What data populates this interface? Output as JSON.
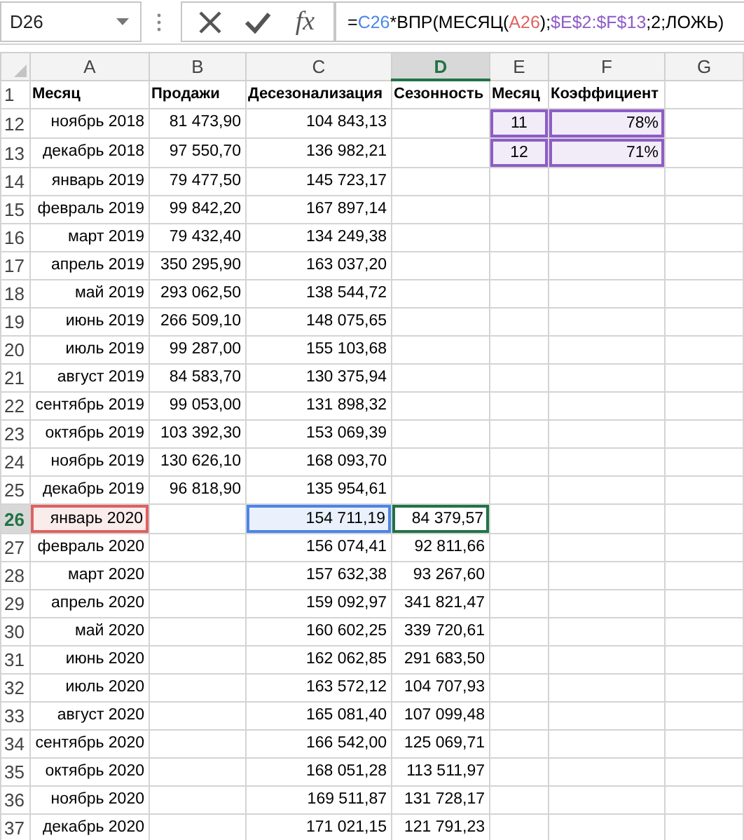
{
  "name_box": "D26",
  "function_button": "fx",
  "formula": [
    {
      "text": "=",
      "color": "#000000"
    },
    {
      "text": "C26",
      "color": "#4a86e8"
    },
    {
      "text": "*ВПР(МЕСЯЦ(",
      "color": "#000000"
    },
    {
      "text": "A26",
      "color": "#e06060"
    },
    {
      "text": ");",
      "color": "#000000"
    },
    {
      "text": "$E$2:$F$13",
      "color": "#8e5cc8"
    },
    {
      "text": ";2;ЛОЖЬ)",
      "color": "#000000"
    }
  ],
  "columns": [
    {
      "label": "A",
      "selected": false
    },
    {
      "label": "B",
      "selected": false
    },
    {
      "label": "C",
      "selected": false
    },
    {
      "label": "D",
      "selected": true
    },
    {
      "label": "E",
      "selected": false
    },
    {
      "label": "F",
      "selected": false
    },
    {
      "label": "G",
      "selected": false
    }
  ],
  "rows": [
    {
      "row": "1",
      "kind": "header",
      "selected": false,
      "cells": [
        "Месяц",
        "Продажи",
        "Десезонализация",
        "Сезонность",
        "Месяц",
        "Коэффициент",
        ""
      ]
    },
    {
      "row": "12",
      "kind": "data",
      "selected": false,
      "cells": [
        "ноябрь 2018",
        "81 473,90",
        "104 843,13",
        "",
        {
          "text": "11",
          "color": "#8e5cc8"
        },
        {
          "text": "78%",
          "color": "#8e5cc8"
        },
        ""
      ]
    },
    {
      "row": "13",
      "kind": "data",
      "selected": false,
      "cells": [
        "декабрь 2018",
        "97 550,70",
        "136 982,21",
        "",
        {
          "text": "12",
          "color": "#8e5cc8"
        },
        {
          "text": "71%",
          "color": "#8e5cc8"
        },
        ""
      ]
    },
    {
      "row": "14",
      "kind": "data",
      "selected": false,
      "cells": [
        "январь 2019",
        "79 477,50",
        "145 723,17",
        "",
        "",
        "",
        ""
      ]
    },
    {
      "row": "15",
      "kind": "data",
      "selected": false,
      "cells": [
        "февраль 2019",
        "99 842,20",
        "167 897,14",
        "",
        "",
        "",
        ""
      ]
    },
    {
      "row": "16",
      "kind": "data",
      "selected": false,
      "cells": [
        "март 2019",
        "79 432,40",
        "134 249,38",
        "",
        "",
        "",
        ""
      ]
    },
    {
      "row": "17",
      "kind": "data",
      "selected": false,
      "cells": [
        "апрель 2019",
        "350 295,90",
        "163 037,20",
        "",
        "",
        "",
        ""
      ]
    },
    {
      "row": "18",
      "kind": "data",
      "selected": false,
      "cells": [
        "май 2019",
        "293 062,50",
        "138 544,72",
        "",
        "",
        "",
        ""
      ]
    },
    {
      "row": "19",
      "kind": "data",
      "selected": false,
      "cells": [
        "июнь 2019",
        "266 509,10",
        "148 075,65",
        "",
        "",
        "",
        ""
      ]
    },
    {
      "row": "20",
      "kind": "data",
      "selected": false,
      "cells": [
        "июль 2019",
        "99 287,00",
        "155 103,68",
        "",
        "",
        "",
        ""
      ]
    },
    {
      "row": "21",
      "kind": "data",
      "selected": false,
      "cells": [
        "август 2019",
        "84 583,70",
        "130 375,94",
        "",
        "",
        "",
        ""
      ]
    },
    {
      "row": "22",
      "kind": "data",
      "selected": false,
      "cells": [
        "сентябрь 2019",
        "99 053,00",
        "131 898,32",
        "",
        "",
        "",
        ""
      ]
    },
    {
      "row": "23",
      "kind": "data",
      "selected": false,
      "cells": [
        "октябрь 2019",
        "103 392,30",
        "153 069,39",
        "",
        "",
        "",
        ""
      ]
    },
    {
      "row": "24",
      "kind": "data",
      "selected": false,
      "cells": [
        "ноябрь 2019",
        "130 626,10",
        "168 093,70",
        "",
        "",
        "",
        ""
      ]
    },
    {
      "row": "25",
      "kind": "data",
      "selected": false,
      "cells": [
        "декабрь 2019",
        "96 818,90",
        "135 954,61",
        "",
        "",
        "",
        ""
      ]
    },
    {
      "row": "26",
      "kind": "data",
      "selected": true,
      "cells": [
        {
          "text": "январь 2020",
          "color": "#e06060"
        },
        "",
        {
          "text": "154 711,19",
          "color": "#4a86e8"
        },
        {
          "text": "84 379,57",
          "selected": true
        },
        "",
        "",
        ""
      ]
    },
    {
      "row": "27",
      "kind": "data",
      "selected": false,
      "cells": [
        "февраль 2020",
        "",
        "156 074,41",
        "92 811,66",
        "",
        "",
        ""
      ]
    },
    {
      "row": "28",
      "kind": "data",
      "selected": false,
      "cells": [
        "март 2020",
        "",
        "157 632,38",
        "93 267,60",
        "",
        "",
        ""
      ]
    },
    {
      "row": "29",
      "kind": "data",
      "selected": false,
      "cells": [
        "апрель 2020",
        "",
        "159 092,97",
        "341 821,47",
        "",
        "",
        ""
      ]
    },
    {
      "row": "30",
      "kind": "data",
      "selected": false,
      "cells": [
        "май 2020",
        "",
        "160 602,25",
        "339 720,61",
        "",
        "",
        ""
      ]
    },
    {
      "row": "31",
      "kind": "data",
      "selected": false,
      "cells": [
        "июнь 2020",
        "",
        "162 062,85",
        "291 683,50",
        "",
        "",
        ""
      ]
    },
    {
      "row": "32",
      "kind": "data",
      "selected": false,
      "cells": [
        "июль 2020",
        "",
        "163 572,12",
        "104 707,93",
        "",
        "",
        ""
      ]
    },
    {
      "row": "33",
      "kind": "data",
      "selected": false,
      "cells": [
        "август 2020",
        "",
        "165 081,40",
        "107 099,48",
        "",
        "",
        ""
      ]
    },
    {
      "row": "34",
      "kind": "data",
      "selected": false,
      "cells": [
        "сентябрь 2020",
        "",
        "166 542,00",
        "125 069,71",
        "",
        "",
        ""
      ]
    },
    {
      "row": "35",
      "kind": "data",
      "selected": false,
      "cells": [
        "октябрь 2020",
        "",
        "168 051,28",
        "113 511,97",
        "",
        "",
        ""
      ]
    },
    {
      "row": "36",
      "kind": "data",
      "selected": false,
      "cells": [
        "ноябрь 2020",
        "",
        "169 511,87",
        "131 728,17",
        "",
        "",
        ""
      ]
    },
    {
      "row": "37",
      "kind": "data",
      "selected": false,
      "cells": [
        "декабрь 2020",
        "",
        "171 021,15",
        "121 791,23",
        "",
        "",
        ""
      ]
    }
  ]
}
